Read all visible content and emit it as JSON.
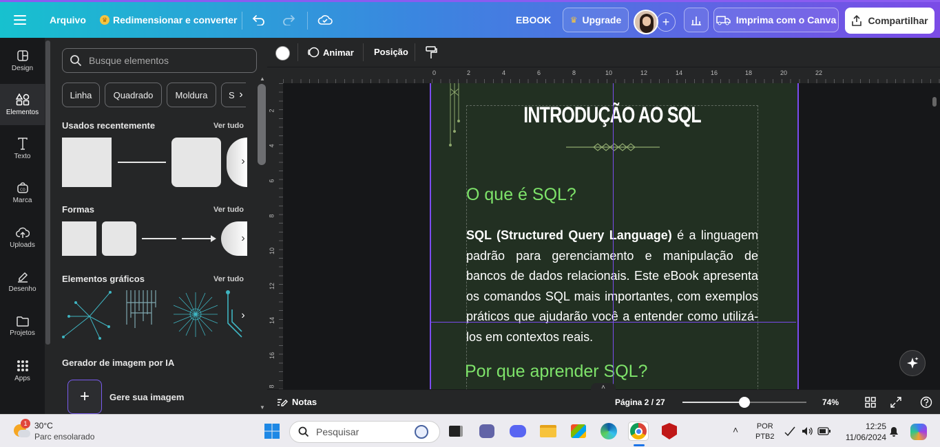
{
  "topbar": {
    "menu_icon": "menu-icon",
    "file_label": "Arquivo",
    "resize_label": "Redimensionar e converter",
    "doc_title": "EBOOK",
    "upgrade_label": "Upgrade",
    "print_label": "Imprima com o Canva",
    "share_label": "Compartilhar"
  },
  "rail": {
    "items": [
      {
        "label": "Design",
        "icon": "design-icon"
      },
      {
        "label": "Elementos",
        "icon": "elements-icon"
      },
      {
        "label": "Texto",
        "icon": "text-icon"
      },
      {
        "label": "Marca",
        "icon": "brand-icon"
      },
      {
        "label": "Uploads",
        "icon": "upload-icon"
      },
      {
        "label": "Desenho",
        "icon": "draw-icon"
      },
      {
        "label": "Projetos",
        "icon": "folder-icon"
      },
      {
        "label": "Apps",
        "icon": "apps-icon"
      }
    ]
  },
  "panel": {
    "search_placeholder": "Busque elementos",
    "chips": [
      "Linha",
      "Quadrado",
      "Moldura",
      "Se"
    ],
    "recent_title": "Usados recentemente",
    "shapes_title": "Formas",
    "graphics_title": "Elementos gráficos",
    "see_all": "Ver tudo",
    "ai_title": "Gerador de imagem por IA",
    "ai_generate": "Gere sua imagem"
  },
  "toolbar2": {
    "animate_label": "Animar",
    "position_label": "Posição"
  },
  "ruler": {
    "top_ticks": [
      "0",
      "2",
      "4",
      "6",
      "8",
      "10",
      "12",
      "14",
      "16",
      "18",
      "20",
      "22"
    ],
    "left_ticks": [
      "2",
      "4",
      "6",
      "8",
      "10",
      "12",
      "14",
      "16",
      "8"
    ]
  },
  "page": {
    "title": "INTRODUÇÃO AO SQL",
    "heading1": "O que é SQL?",
    "para_bold": "SQL (Structured Query Language)",
    "para_rest": " é a linguagem padrão para gerenciamento e manipulação de bancos de dados relacionais. Este eBook apresenta os comandos SQL mais importantes, com exemplos práticos que ajudarão você a entender como utilizá-los em contextos reais.",
    "heading2": "Por que aprender SQL?",
    "accent": "#7ee36a",
    "background": "#223022"
  },
  "footer": {
    "notes_label": "Notas",
    "page_label": "Página 2 / 27",
    "zoom_label": "74%",
    "zoom_level": 0.5
  },
  "taskbar": {
    "weather_temp": "30°C",
    "weather_desc": "Parc ensolarado",
    "weather_badge": "1",
    "search_placeholder": "Pesquisar",
    "lang_top": "POR",
    "lang_bottom": "PTB2",
    "time": "12:25",
    "date": "11/06/2024"
  }
}
